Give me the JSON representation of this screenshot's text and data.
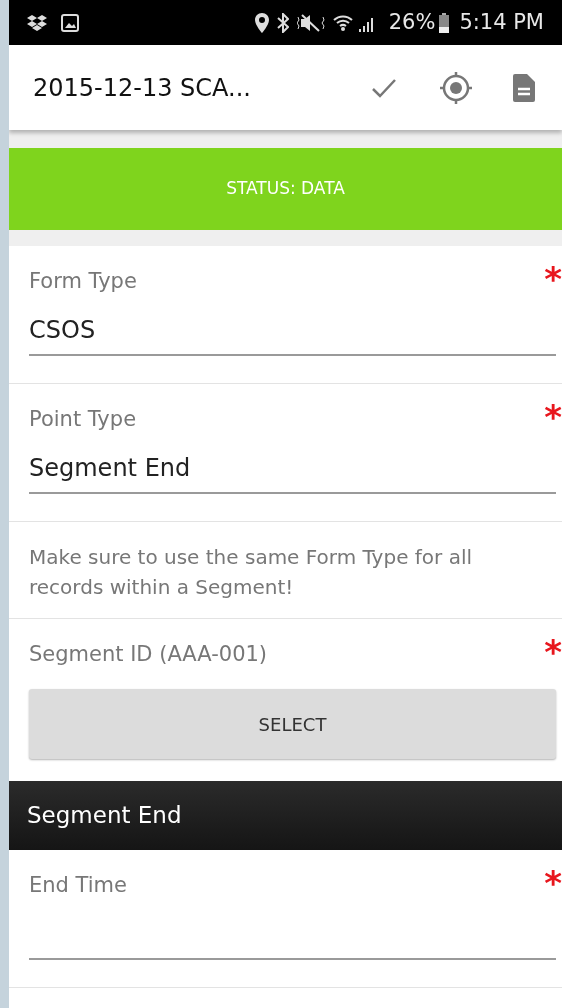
{
  "status_bar": {
    "battery": "26%",
    "time": "5:14 PM"
  },
  "toolbar": {
    "title": "2015-12-13 SCA..."
  },
  "status_banner": {
    "text": "STATUS: DATA"
  },
  "form": [
    {
      "kind": "field",
      "label": "Form Type",
      "value": "CSOS",
      "required_marker": "*"
    },
    {
      "kind": "field",
      "label": "Point Type",
      "value": "Segment End",
      "required_marker": "*"
    },
    {
      "kind": "note",
      "text": "Make sure to use the same Form Type for all records within a Segment!"
    },
    {
      "kind": "select",
      "label": "Segment ID (AAA-001)",
      "button": "SELECT",
      "required_marker": "*"
    },
    {
      "kind": "header",
      "text": "Segment End"
    },
    {
      "kind": "field",
      "label": "End Time",
      "required_marker": "*"
    }
  ]
}
